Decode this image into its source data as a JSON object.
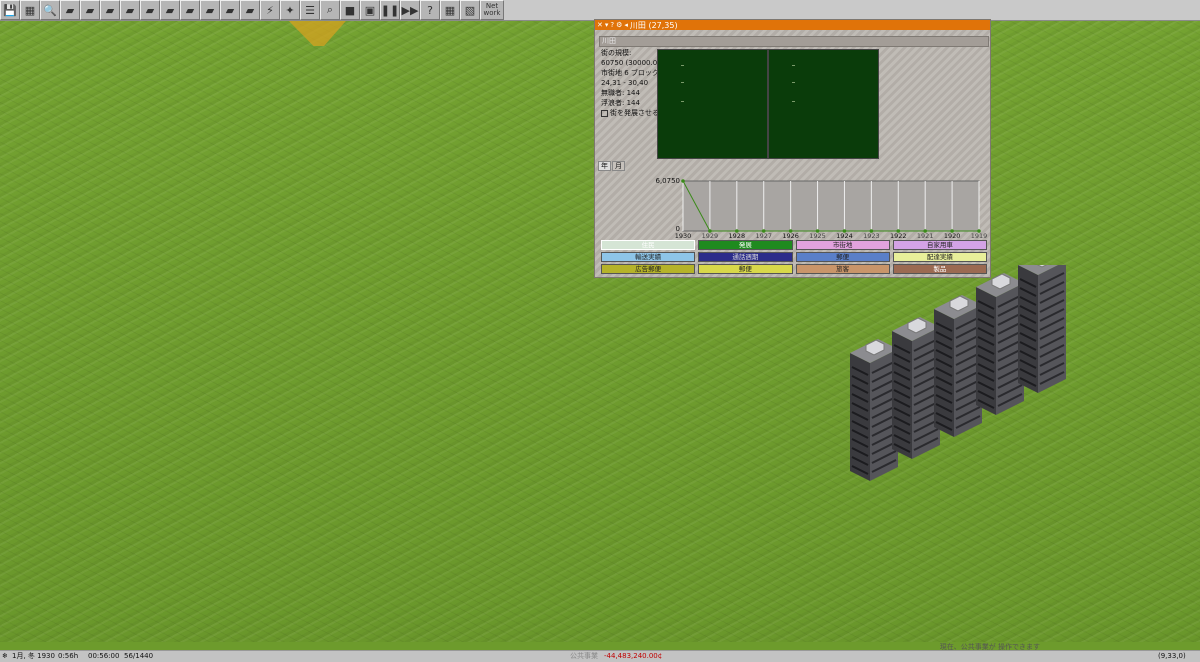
{
  "toolbar": {
    "buttons": [
      {
        "name": "save-button",
        "glyph": "💾"
      },
      {
        "name": "map-button",
        "glyph": "▦"
      },
      {
        "name": "zoom-button",
        "glyph": "🔍"
      },
      {
        "name": "terrain-button",
        "glyph": "▰"
      },
      {
        "name": "rail-button",
        "glyph": "▰"
      },
      {
        "name": "road-button",
        "glyph": "▰"
      },
      {
        "name": "tram-button",
        "glyph": "▰"
      },
      {
        "name": "monorail-button",
        "glyph": "▰"
      },
      {
        "name": "maglev-button",
        "glyph": "▰"
      },
      {
        "name": "ship-button",
        "glyph": "▰"
      },
      {
        "name": "air-button",
        "glyph": "▰"
      },
      {
        "name": "port-button",
        "glyph": "▰"
      },
      {
        "name": "vehicle-button",
        "glyph": "▰"
      },
      {
        "name": "power-button",
        "glyph": "⚡"
      },
      {
        "name": "special-button",
        "glyph": "✦"
      },
      {
        "name": "list-button",
        "glyph": "☰"
      },
      {
        "name": "inspect-button",
        "glyph": "⌕"
      },
      {
        "name": "build-button",
        "glyph": "■"
      },
      {
        "name": "screenshot-button",
        "glyph": "▣"
      },
      {
        "name": "pause-button",
        "glyph": "❚❚"
      },
      {
        "name": "fastforward-button",
        "glyph": "▶▶"
      },
      {
        "name": "help-button",
        "glyph": "?"
      },
      {
        "name": "settings-button",
        "glyph": "▦"
      },
      {
        "name": "grid-button",
        "glyph": "▧"
      }
    ],
    "network_label": "Net\nwork"
  },
  "window": {
    "title": "川田 (27,35)",
    "city_name": "川田",
    "info": [
      "街の規模:",
      "60750 (30000.0)",
      "市街地 6 ブロック",
      "24,31 - 30,40",
      "無職者: 144",
      "浮浪者: 144"
    ],
    "checkbox_label": "街を発展させる",
    "tabs": [
      "年",
      "月"
    ],
    "chart_data": {
      "type": "line",
      "x": [
        "1930",
        "1929",
        "1928",
        "1927",
        "1926",
        "1925",
        "1924",
        "1923",
        "1922",
        "1921",
        "1920",
        "1919"
      ],
      "series": [
        {
          "values": [
            6075,
            0,
            0,
            0,
            0,
            0,
            0,
            0,
            0,
            0,
            0,
            0
          ]
        }
      ],
      "y_tick_labels": [
        "6,0750",
        "0"
      ],
      "ylim": [
        0,
        6075
      ],
      "color": "#3b8a1a"
    },
    "legend": [
      {
        "label": "住民",
        "bg": "#d5e5d5",
        "fg": "#fff",
        "active": true
      },
      {
        "label": "発展",
        "bg": "#1f8a1f",
        "fg": "#fff"
      },
      {
        "label": "市街地",
        "bg": "#e2a2de",
        "fg": "#222"
      },
      {
        "label": "自家用車",
        "bg": "#d4a3e6",
        "fg": "#222"
      },
      {
        "label": "輸送実績",
        "bg": "#8ec5e8",
        "fg": "#222"
      },
      {
        "label": "通話週期",
        "bg": "#2c2c8a",
        "fg": "#ddd"
      },
      {
        "label": "郵便",
        "bg": "#5a7fc8",
        "fg": "#222"
      },
      {
        "label": "配達実績",
        "bg": "#e8ef9a",
        "fg": "#222"
      },
      {
        "label": "広告郵便",
        "bg": "#b5b32a",
        "fg": "#222"
      },
      {
        "label": "郵便",
        "bg": "#d8d84a",
        "fg": "#222"
      },
      {
        "label": "旅客",
        "bg": "#c9956a",
        "fg": "#222"
      },
      {
        "label": "製品",
        "bg": "#9b6a52",
        "fg": "#fff"
      }
    ]
  },
  "status": {
    "date": "1月, 冬 1930",
    "clock": "0:56h",
    "elapsed": "00:56:00",
    "fps": "56/1440",
    "public_label": "公共事業",
    "money": "-44,483,240.00¢",
    "money_color": "#c00000",
    "coords": "(9,33,0)",
    "message": "現在、公共事業が 操作できます"
  }
}
